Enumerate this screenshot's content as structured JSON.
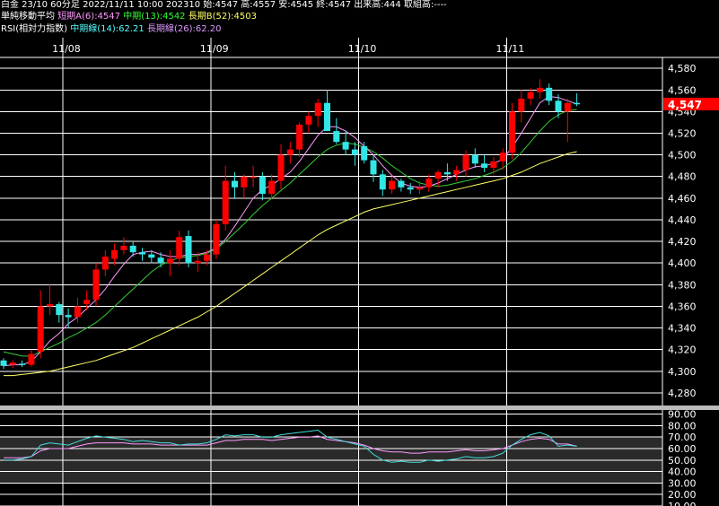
{
  "header": {
    "line1": "白金 23/10 60分足 2022/11/11 10:00 202310 始:4547 高:4557 安:4545 終:4547 出来高:444 取組高:----",
    "ma_title": "単純移動平均",
    "ma_short": "短期A(6):4547",
    "ma_mid": "中期(13):4542",
    "ma_long": "長期B(52):4503",
    "rsi_title": "RSI(相対力指数)",
    "rsi_mid": "中期線(14):62.21",
    "rsi_long": "長期線(26):62.20"
  },
  "colors": {
    "up": "#ff0000",
    "down": "#33e6e6",
    "ma_short": "#ff99ff",
    "ma_mid": "#33cc33",
    "ma_long": "#ffff66",
    "rsi_mid": "#44dddd",
    "rsi_long": "#ff99ff",
    "grid": "#ffffff",
    "price_tag_bg": "#ff0000"
  },
  "chart_data": [
    {
      "type": "candlestick",
      "x_dates": [
        {
          "label": "11/08",
          "index": 7
        },
        {
          "label": "11/09",
          "index": 23
        },
        {
          "label": "11/10",
          "index": 39
        },
        {
          "label": "11/11",
          "index": 55
        }
      ],
      "ylim": [
        4270,
        4605
      ],
      "yticks": [
        4280,
        4300,
        4320,
        4340,
        4360,
        4380,
        4400,
        4420,
        4440,
        4460,
        4480,
        4500,
        4520,
        4540,
        4560,
        4580
      ],
      "last_price": "4,547",
      "last_value": 4547,
      "candles": [
        [
          4310,
          4312,
          4302,
          4305
        ],
        [
          4306,
          4310,
          4303,
          4308
        ],
        [
          4307,
          4310,
          4304,
          4306
        ],
        [
          4306,
          4320,
          4304,
          4316
        ],
        [
          4318,
          4375,
          4312,
          4360
        ],
        [
          4360,
          4380,
          4352,
          4362
        ],
        [
          4362,
          4364,
          4345,
          4352
        ],
        [
          4352,
          4358,
          4340,
          4350
        ],
        [
          4350,
          4368,
          4345,
          4360
        ],
        [
          4362,
          4375,
          4356,
          4366
        ],
        [
          4366,
          4400,
          4360,
          4394
        ],
        [
          4394,
          4412,
          4388,
          4406
        ],
        [
          4404,
          4418,
          4398,
          4412
        ],
        [
          4412,
          4424,
          4408,
          4416
        ],
        [
          4416,
          4420,
          4406,
          4410
        ],
        [
          4410,
          4414,
          4402,
          4408
        ],
        [
          4408,
          4412,
          4400,
          4405
        ],
        [
          4405,
          4410,
          4396,
          4400
        ],
        [
          4400,
          4412,
          4388,
          4404
        ],
        [
          4404,
          4430,
          4398,
          4424
        ],
        [
          4425,
          4430,
          4396,
          4400
        ],
        [
          4400,
          4410,
          4392,
          4402
        ],
        [
          4402,
          4412,
          4398,
          4408
        ],
        [
          4408,
          4440,
          4404,
          4436
        ],
        [
          4436,
          4490,
          4430,
          4476
        ],
        [
          4476,
          4484,
          4460,
          4470
        ],
        [
          4470,
          4482,
          4460,
          4480
        ],
        [
          4480,
          4490,
          4470,
          4480
        ],
        [
          4480,
          4484,
          4458,
          4464
        ],
        [
          4464,
          4482,
          4460,
          4476
        ],
        [
          4476,
          4510,
          4468,
          4500
        ],
        [
          4500,
          4512,
          4492,
          4505
        ],
        [
          4505,
          4530,
          4498,
          4528
        ],
        [
          4528,
          4540,
          4520,
          4536
        ],
        [
          4536,
          4552,
          4526,
          4548
        ],
        [
          4548,
          4560,
          4530,
          4522
        ],
        [
          4522,
          4534,
          4510,
          4512
        ],
        [
          4512,
          4522,
          4500,
          4505
        ],
        [
          4505,
          4512,
          4490,
          4500
        ],
        [
          4508,
          4512,
          4492,
          4495
        ],
        [
          4495,
          4500,
          4475,
          4482
        ],
        [
          4482,
          4486,
          4462,
          4468
        ],
        [
          4468,
          4480,
          4464,
          4476
        ],
        [
          4476,
          4478,
          4466,
          4470
        ],
        [
          4470,
          4474,
          4464,
          4468
        ],
        [
          4468,
          4476,
          4464,
          4470
        ],
        [
          4470,
          4482,
          4466,
          4478
        ],
        [
          4478,
          4486,
          4470,
          4484
        ],
        [
          4484,
          4492,
          4476,
          4482
        ],
        [
          4482,
          4490,
          4476,
          4486
        ],
        [
          4486,
          4504,
          4480,
          4500
        ],
        [
          4500,
          4506,
          4488,
          4492
        ],
        [
          4492,
          4500,
          4484,
          4488
        ],
        [
          4488,
          4498,
          4482,
          4494
        ],
        [
          4494,
          4506,
          4486,
          4502
        ],
        [
          4502,
          4548,
          4496,
          4540
        ],
        [
          4540,
          4560,
          4530,
          4552
        ],
        [
          4552,
          4562,
          4546,
          4558
        ],
        [
          4558,
          4570,
          4552,
          4562
        ],
        [
          4562,
          4566,
          4546,
          4550
        ],
        [
          4550,
          4556,
          4534,
          4540
        ],
        [
          4540,
          4552,
          4512,
          4548
        ],
        [
          4548,
          4557,
          4545,
          4547
        ]
      ],
      "ma_short": [
        4305,
        4306,
        4306,
        4309,
        4318,
        4328,
        4335,
        4344,
        4350,
        4358,
        4366,
        4376,
        4388,
        4399,
        4408,
        4410,
        4411,
        4408,
        4406,
        4406,
        4408,
        4408,
        4410,
        4414,
        4422,
        4434,
        4447,
        4460,
        4468,
        4472,
        4478,
        4484,
        4494,
        4506,
        4518,
        4526,
        4526,
        4522,
        4516,
        4508,
        4500,
        4490,
        4481,
        4474,
        4471,
        4470,
        4471,
        4474,
        4478,
        4482,
        4486,
        4489,
        4490,
        4492,
        4496,
        4507,
        4520,
        4534,
        4548,
        4554,
        4553,
        4550,
        4547
      ],
      "ma_mid": [
        4318,
        4316,
        4314,
        4314,
        4318,
        4322,
        4326,
        4331,
        4335,
        4340,
        4345,
        4352,
        4360,
        4368,
        4376,
        4384,
        4392,
        4398,
        4402,
        4405,
        4406,
        4407,
        4409,
        4413,
        4420,
        4428,
        4436,
        4445,
        4453,
        4460,
        4467,
        4474,
        4482,
        4490,
        4498,
        4505,
        4509,
        4511,
        4510,
        4507,
        4503,
        4497,
        4490,
        4484,
        4478,
        4474,
        4472,
        4471,
        4472,
        4474,
        4476,
        4478,
        4481,
        4484,
        4488,
        4494,
        4502,
        4512,
        4522,
        4531,
        4537,
        4541,
        4542
      ],
      "ma_long": [
        4296,
        4296,
        4297,
        4298,
        4299,
        4300,
        4302,
        4304,
        4306,
        4308,
        4310,
        4313,
        4316,
        4319,
        4322,
        4326,
        4330,
        4334,
        4338,
        4342,
        4346,
        4350,
        4355,
        4360,
        4366,
        4372,
        4378,
        4384,
        4390,
        4396,
        4402,
        4408,
        4414,
        4420,
        4426,
        4431,
        4435,
        4439,
        4443,
        4447,
        4450,
        4452,
        4454,
        4456,
        4458,
        4460,
        4462,
        4464,
        4466,
        4468,
        4470,
        4472,
        4474,
        4476,
        4478,
        4481,
        4484,
        4488,
        4492,
        4495,
        4498,
        4501,
        4503
      ]
    },
    {
      "type": "line",
      "title": "RSI",
      "ylim": [
        10,
        92
      ],
      "yticks": [
        90.0,
        80.0,
        70.0,
        60.0,
        50.0,
        40.0,
        30.0,
        20.0,
        10.0
      ],
      "ytick_labels": [
        "90.00",
        "80.00",
        "70.00",
        "60.00",
        "50.00",
        "40.00",
        "30.00",
        "20.00",
        "10.00"
      ],
      "band": [
        30,
        70
      ],
      "rsi_mid": [
        50,
        50,
        51,
        53,
        63,
        65,
        64,
        63,
        66,
        69,
        71,
        70,
        69,
        68,
        66,
        67,
        66,
        65,
        65,
        63,
        64,
        64,
        65,
        68,
        72,
        71,
        72,
        72,
        70,
        70,
        72,
        73,
        74,
        75,
        76,
        70,
        68,
        66,
        64,
        62,
        55,
        50,
        48,
        49,
        48,
        48,
        50,
        49,
        50,
        51,
        53,
        52,
        52,
        53,
        56,
        63,
        68,
        72,
        74,
        71,
        62,
        63,
        62
      ],
      "rsi_long": [
        52,
        52,
        52,
        53,
        58,
        60,
        60,
        60,
        62,
        64,
        65,
        65,
        65,
        65,
        64,
        64,
        64,
        63,
        63,
        63,
        63,
        63,
        63,
        65,
        67,
        67,
        68,
        68,
        68,
        67,
        68,
        69,
        70,
        70,
        71,
        68,
        67,
        66,
        65,
        63,
        60,
        58,
        57,
        57,
        56,
        56,
        57,
        57,
        57,
        58,
        59,
        58,
        58,
        59,
        60,
        63,
        66,
        68,
        69,
        68,
        64,
        64,
        62
      ]
    }
  ]
}
